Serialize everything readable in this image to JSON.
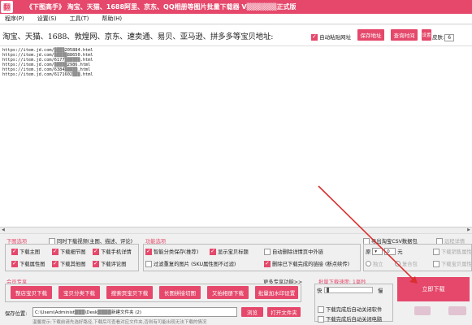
{
  "titlebar": {
    "logo": "翻",
    "title": "《下图高手》 淘宝、天猫、1688阿里、京东、QQ相册等图片批量下载器 V▒▒▒▒▒▒正式版"
  },
  "menu": [
    "程序(P)",
    "设置(S)",
    "工具(T)",
    "帮助(H)"
  ],
  "urlbar": {
    "prompt": "淘宝、天猫、1688、敦煌网、京东、速卖通、易贝、亚马逊、拼多多等宝贝地址:",
    "auto_paste": "自动粘贴网址",
    "save_btn": "保存地址",
    "query_btn": "查询时间",
    "settings_btn": "设置",
    "skin_label": "皮肤:",
    "skin_value": "6"
  },
  "urls": [
    "https://item.jd.com/▒▒▒▒205884.html",
    "https://item.jd.com/▒▒▒▒▒88650.html",
    "https://item.jd.com/6177▒▒▒▒▒▒.html",
    "https://item.jd.com/▒▒▒▒▒2986.html",
    "https://item.jd.com/6384▒▒▒▒▒.html",
    "https://item.jd.com/6171602▒▒▒.html"
  ],
  "download_options": {
    "label": "下图选项",
    "video_opt": "同时下载视频(主图、描述、评论)",
    "items": [
      "下载主图",
      "下载细节图",
      "下载手机详情",
      "下载属性图",
      "下载其他图",
      "下载评论图"
    ]
  },
  "func_options": {
    "label": "功能选项",
    "items": [
      "智能分类保存(推荐)",
      "显示宝贝标题",
      "自动删除详情页中外链",
      "过滤重复的图片 (SKU属性图不过滤)",
      "删除已下载完成的链接 (断点续传)"
    ]
  },
  "right_options": {
    "export_csv": "导出淘宝CSV数据包",
    "remote_detail": "远程详情",
    "size_label": "原",
    "size_value": "0",
    "size_unit": "元",
    "dl_sales": "下载销售属性",
    "independent": "独立",
    "composite": "复合包",
    "dl_sku": "下载宝贝属性"
  },
  "vip": {
    "label": "会员专享",
    "more": "更多专享功能>>",
    "buttons": [
      "整店宝贝下载",
      "宝贝分类下载",
      "搜索页宝贝下载",
      "长图拼接切图",
      "又拍相册下载",
      "批量加水印设置"
    ]
  },
  "speed": {
    "label": "批量下载速度:",
    "value": "1毫秒",
    "fast": "快",
    "slow": "慢",
    "after_close_software": "下载完成后自动关闭软件",
    "after_close_pc": "下载完成后自动关闭电脑"
  },
  "save": {
    "label": "保存位置:",
    "path": "C:\\Users\\Administ▒▒▒\\Desk▒▒▒▒新建文件夹 (2)",
    "browse": "浏览",
    "open_folder": "打开文件夹",
    "tip": "温馨提示:下载前请先选好路径,下载后可查看对应文件夹,否则有可能出现无法下载的情况"
  },
  "start_btn": "立即下载",
  "colors": {
    "accent": "#e5486b",
    "arrow": "#d9302f"
  }
}
